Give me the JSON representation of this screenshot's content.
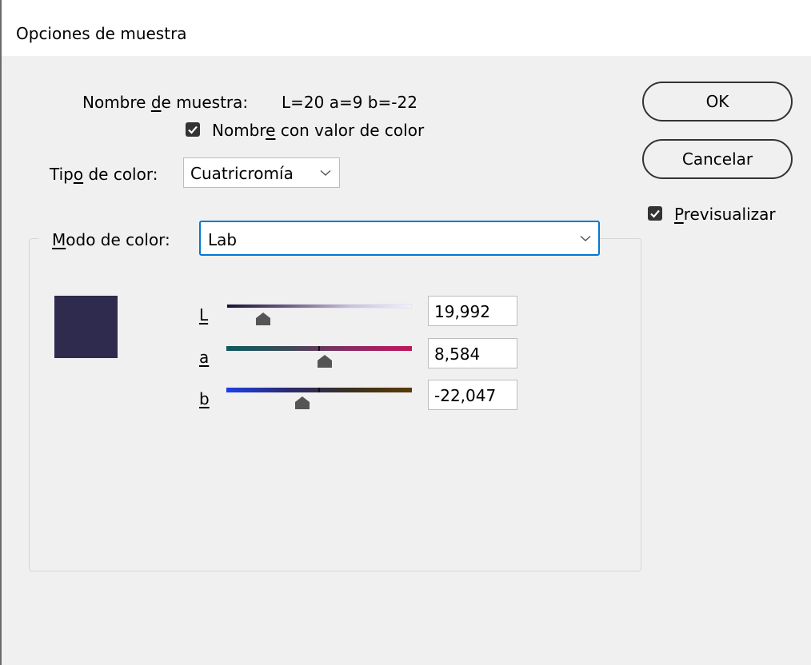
{
  "window": {
    "title": "Opciones de muestra"
  },
  "swatch_name": {
    "label_pre": "Nombre ",
    "label_mnemonic": "d",
    "label_post": "e muestra:",
    "value": "L=20 a=9 b=-22"
  },
  "name_with_color": {
    "label_pre": "Nombr",
    "label_mnemonic": "e",
    "label_post": " con valor de color",
    "checked": true
  },
  "color_type": {
    "label_pre": "Tip",
    "label_mnemonic": "o",
    "label_post": " de color:",
    "value": "Cuatricromía",
    "icon": "chevron-down-icon"
  },
  "color_mode": {
    "label_mnemonic": "M",
    "label_post": "odo de color:",
    "value": "Lab",
    "icon": "chevron-down-icon"
  },
  "buttons": {
    "ok": "OK",
    "cancel": "Cancelar"
  },
  "preview": {
    "label_mnemonic": "P",
    "label_post": "revisualizar",
    "checked": true
  },
  "swatch_color": "#2e2b4e",
  "sliders": [
    {
      "label": "L",
      "value": "19,992",
      "fraction": 0.19992
    },
    {
      "label": "a",
      "value": "8,584",
      "fraction": 0.529
    },
    {
      "label": "b",
      "value": "-22,047",
      "fraction": 0.408
    }
  ],
  "colors": {
    "accent": "#0078d7",
    "checkbox": "#333333"
  }
}
